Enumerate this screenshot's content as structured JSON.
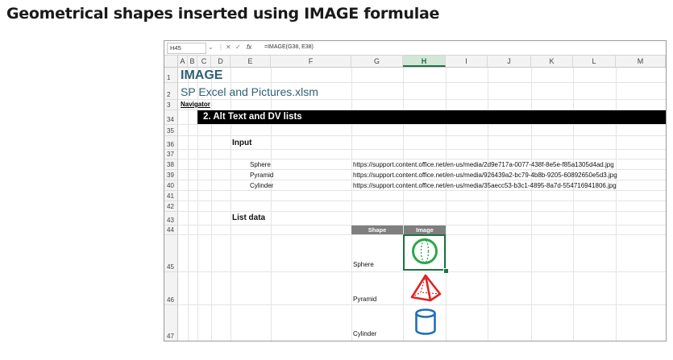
{
  "heading": "Geometrical shapes inserted using IMAGE formulae",
  "formula_bar": {
    "name_box": "H45",
    "fx": "fx",
    "formula": "=IMAGE(G38, E38)"
  },
  "columns": [
    "A",
    "B",
    "C",
    "D",
    "E",
    "F",
    "G",
    "H",
    "I",
    "J",
    "K",
    "L",
    "M"
  ],
  "selected_column": "H",
  "rows": [
    "1",
    "2",
    "3",
    "34",
    "35",
    "36",
    "37",
    "38",
    "39",
    "40",
    "41",
    "42",
    "43",
    "44",
    "45",
    "46",
    "47"
  ],
  "sheet": {
    "title": "IMAGE",
    "filename": "SP Excel and Pictures.xlsm",
    "navigator": "Navigator",
    "section_band": "2.  Alt Text and DV lists",
    "input_heading": "Input",
    "inputs": [
      {
        "name": "Sphere",
        "url": "https://support.content.office.net/en-us/media/2d9e717a-0077-438f-8e5e-f85a1305d4ad.jpg"
      },
      {
        "name": "Pyramid",
        "url": "https://support.content.office.net/en-us/media/926439a2-bc79-4b8b-9205-60892650e5d3.jpg"
      },
      {
        "name": "Cylinder",
        "url": "https://support.content.office.net/en-us/media/35aecc53-b3c1-4895-8a7d-554716941806.jpg"
      }
    ],
    "list_heading": "List data",
    "table_headers": {
      "shape": "Shape",
      "image": "Image"
    },
    "list_items": [
      {
        "name": "Sphere",
        "icon": "sphere-icon",
        "color": "#2aa84a"
      },
      {
        "name": "Pyramid",
        "icon": "pyramid-icon",
        "color": "#e02424"
      },
      {
        "name": "Cylinder",
        "icon": "cylinder-icon",
        "color": "#1f6fb8"
      }
    ]
  },
  "colors": {
    "accent_green": "#1e7145",
    "title_teal": "#2e5f75",
    "band_black": "#000000",
    "table_header_gray": "#7f7f7f"
  }
}
